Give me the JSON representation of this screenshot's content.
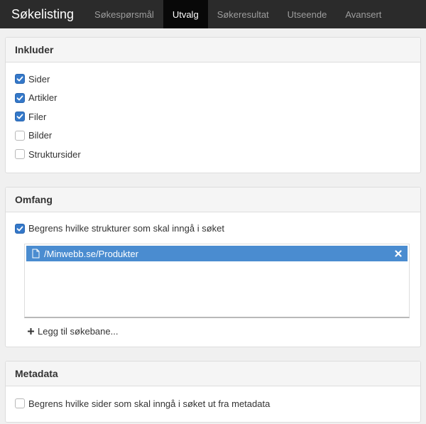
{
  "nav": {
    "brand": "Søkelisting",
    "tabs": [
      {
        "label": "Søkespørsmål",
        "active": false
      },
      {
        "label": "Utvalg",
        "active": true
      },
      {
        "label": "Søkeresultat",
        "active": false
      },
      {
        "label": "Utseende",
        "active": false
      },
      {
        "label": "Avansert",
        "active": false
      }
    ]
  },
  "include": {
    "title": "Inkluder",
    "options": [
      {
        "label": "Sider",
        "checked": true
      },
      {
        "label": "Artikler",
        "checked": true
      },
      {
        "label": "Filer",
        "checked": true
      },
      {
        "label": "Bilder",
        "checked": false
      },
      {
        "label": "Struktursider",
        "checked": false
      }
    ]
  },
  "scope": {
    "title": "Omfang",
    "restrict_label": "Begrens hvilke strukturer som skal inngå i søket",
    "restrict_checked": true,
    "paths": [
      "/Minwebb.se/Produkter"
    ],
    "add_path_label": "Legg til søkebane..."
  },
  "metadata": {
    "title": "Metadata",
    "restrict_label": "Begrens hvilke sider som skal inngå i søket ut fra metadata",
    "restrict_checked": false
  },
  "colors": {
    "navbar": "#2b2b2b",
    "active_tab": "#080808",
    "checkbox_on": "#3478c9",
    "selected_path": "#4a8cd0"
  },
  "icons": {
    "check": "check-icon",
    "file": "file-icon",
    "remove": "close-icon",
    "add": "plus-icon"
  }
}
